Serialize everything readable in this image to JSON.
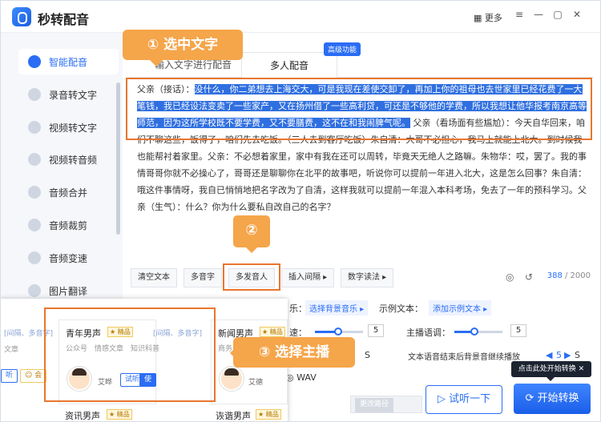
{
  "app": {
    "name": "秒转配音",
    "more": "更多"
  },
  "sidebar": {
    "items": [
      {
        "label": "智能配音",
        "active": true
      },
      {
        "label": "录音转文字"
      },
      {
        "label": "视频转文字"
      },
      {
        "label": "视频转音频"
      },
      {
        "label": "音频合并"
      },
      {
        "label": "音频裁剪"
      },
      {
        "label": "音频变速"
      },
      {
        "label": "图片翻译"
      }
    ]
  },
  "tabs": [
    {
      "label": "输入文字进行配音"
    },
    {
      "label": "多人配音"
    }
  ],
  "badge": "高级功能",
  "text": {
    "speaker1": "父亲（接话）：",
    "highlight": "没什么，你二弟想去上海交大，可是我现在差使交卸了，再加上你的祖母也去世家里已经花费了一大笔钱，我已经设法变卖了一些家产，又在扬州借了一些高利贷，可还是不够他的学费，所以我想让他华报考南京高等师范，因为这所学校既不要学费，又不要膳费，这不在和我闹脾气呢。",
    "rest": "父亲（看场面有些尴尬）：今天自华回来，咱们不聊这些，饭得了，咱们先去吃饭。（三人去到客厅吃饭）朱自清：大哥不必担心，我马上就能上北大。到时候我也能帮衬着家里。父亲：不必想着家里，家中有我在还可以周转，毕竟天无绝人之路嘛。朱物华：哎，罢了。我的事情哥哥你就不必操心了，哥哥还是聊聊你在北平的故事吧，听说你可以提前一年进入北大，这是怎么回事？朱自清：哦这件事情呀，我自已悄悄地把名字改为了自清，这样我就可以提前一年混入本科考场，免去了一年的预科学习。父亲（生气）：什么？你为什么要私自改自己的名字？"
  },
  "toolbar": {
    "buttons": [
      "清空文本",
      "多音字",
      "多发音人",
      "插入间隔 ▸",
      "数字读法 ▸"
    ],
    "count": "388",
    "total": " / 2000"
  },
  "settings": {
    "bgm_label": "乐：",
    "bgm_link": "选择背景音乐 ▸",
    "sample_label": "示例文本：",
    "sample_link": "添加示例文本 ▸",
    "speed_label": "速：",
    "speed_value": "5",
    "tone_label": "主播语调：",
    "tone_value": "5",
    "end_text": "文本语音结束后背景音继续播放",
    "end_value": "5",
    "s1": "S",
    "s2": "S",
    "format": "WAV",
    "change_path": "更改路径"
  },
  "voices": [
    {
      "name": "青年男声",
      "badge": "★ 精品",
      "tags": "公众号　情感文章　知识科普",
      "person": "艾晔",
      "try": "试听",
      "use": "使用"
    },
    {
      "name": "新闻男声",
      "badge": "★ 精品",
      "person": "艾德"
    },
    {
      "name": "资讯男声",
      "badge": "★ 精品"
    },
    {
      "name": "诙谐男声",
      "badge": "★ 精品"
    }
  ],
  "voice_partial": {
    "tags_left": "[间隔、多音字]",
    "tags_right": "[间隔、多音字]",
    "cat_left": "文章",
    "cat_right": "商务",
    "listen": "听",
    "vip": "会"
  },
  "buttons": {
    "try": "试听一下",
    "start": "开始转换",
    "tooltip": "点击此处开始转换"
  },
  "annotations": {
    "step1": "① 选中文字",
    "step2": "②",
    "step3": "③ 选择主播"
  }
}
